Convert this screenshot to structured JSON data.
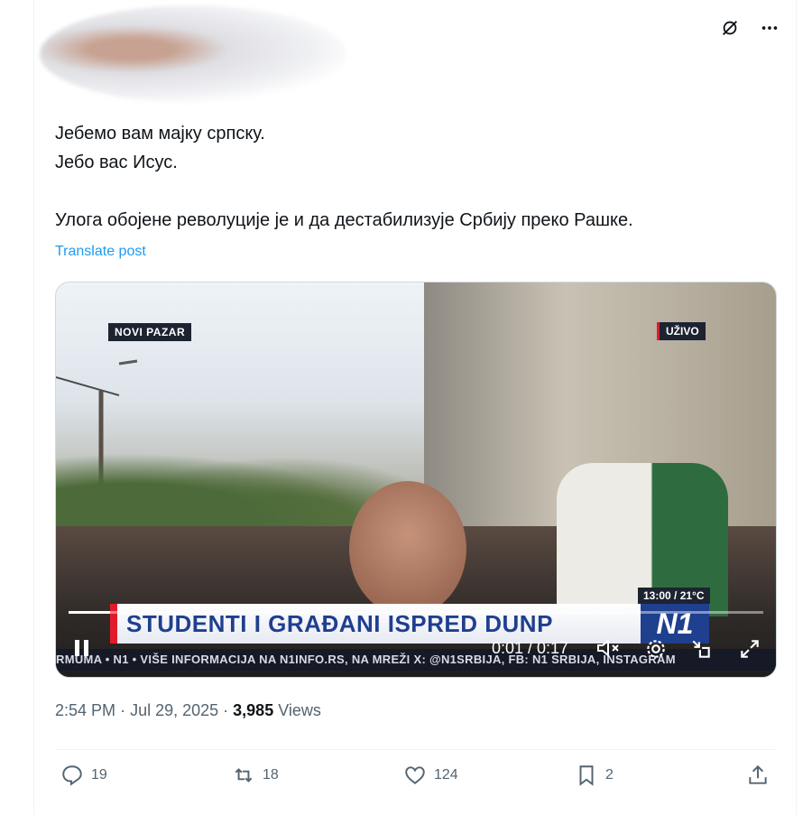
{
  "post": {
    "lines": [
      "Јебемо вам мајку српску.",
      "Јебо вас Исус.",
      "Улога обојене револуције је и да дестабилизује Србију преко Рашке."
    ],
    "translate_label": "Translate post"
  },
  "video": {
    "location_tag": "NOVI PAZAR",
    "live_tag": "UŽIVO",
    "time_temp": "13:00 / 21°C",
    "headline": "STUDENTI I GRAĐANI ISPRED DUNP",
    "logo": "N1",
    "ticker": "RMUMA • N1 • VIŠE INFORMACIJA NA N1INFO.RS, NA MREŽI X: @N1SRBIJA, FB: N1 SRBIJA, INSTAGRAM",
    "time_readout": "0:01 / 0:17",
    "progress": 0.06
  },
  "meta": {
    "time": "2:54 PM",
    "date": "Jul 29, 2025",
    "views_count": "3,985",
    "views_label": "Views"
  },
  "actions": {
    "replies": "19",
    "reposts": "18",
    "likes": "124",
    "bookmarks": "2"
  },
  "icons": [
    "grok-icon",
    "more-icon",
    "pause-icon",
    "mute-icon",
    "settings-icon",
    "pip-icon",
    "fullscreen-icon",
    "reply-icon",
    "repost-icon",
    "like-icon",
    "bookmark-icon",
    "share-icon"
  ],
  "colors": {
    "link": "#1d9bf0",
    "muted": "#536471",
    "text": "#0f1419",
    "n1_blue": "#1f3f8f",
    "n1_red": "#e21b2c"
  }
}
